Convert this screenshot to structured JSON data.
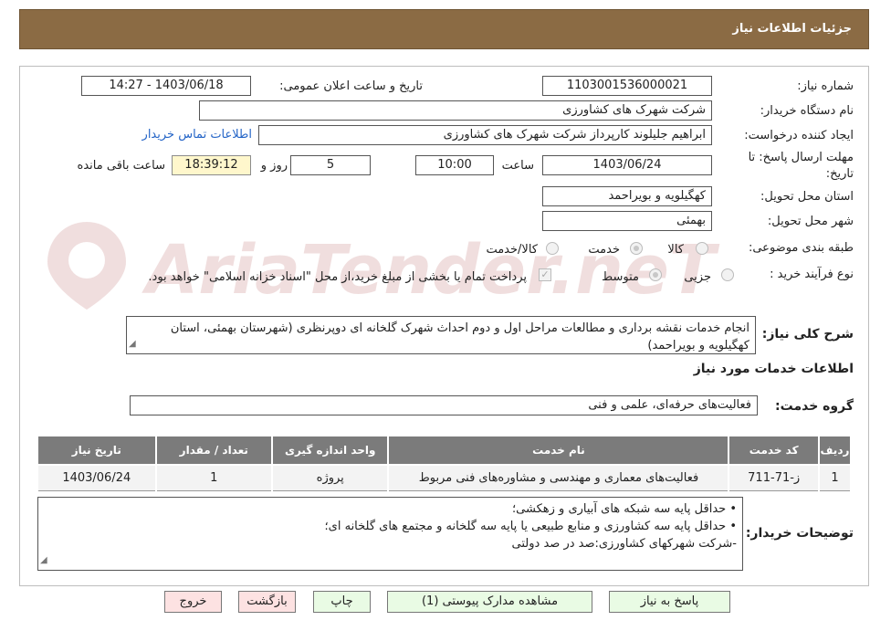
{
  "header": {
    "title": "جزئیات اطلاعات نیاز"
  },
  "form": {
    "need_number_label": "شماره نیاز:",
    "need_number": "1103001536000021",
    "announce_label": "تاریخ و ساعت اعلان عمومی:",
    "announce_value": "1403/06/18 - 14:27",
    "buyer_org_label": "نام دستگاه خریدار:",
    "buyer_org": "شرکت شهرک های کشاورزی",
    "creator_label": "ایجاد کننده درخواست:",
    "creator": "ابراهیم جلیلوند کارپرداز شرکت شهرک های کشاورزی",
    "contact_link": "اطلاعات تماس خریدار",
    "deadline_label_1": "مهلت ارسال پاسخ: تا",
    "deadline_label_2": "تاریخ:",
    "deadline_date": "1403/06/24",
    "time_label": "ساعت",
    "deadline_time": "10:00",
    "days_value": "5",
    "days_label": "روز و",
    "remaining_time": "18:39:12",
    "remaining_label": "ساعت باقی مانده",
    "province_label": "استان محل تحویل:",
    "province": "کهگیلویه و بویراحمد",
    "city_label": "شهر محل تحویل:",
    "city": "بهمئی",
    "category_label": "طبقه بندی موضوعی:",
    "category_options": [
      "کالا",
      "خدمت",
      "کالا/خدمت"
    ],
    "category_selected": "خدمت",
    "process_label": "نوع فرآیند خرید :",
    "process_options": [
      "جزیی",
      "متوسط"
    ],
    "process_selected": "متوسط",
    "payment_note": "پرداخت تمام یا بخشی از مبلغ خرید،از محل \"اسناد خزانه اسلامی\" خواهد بود."
  },
  "description": {
    "label": "شرح کلی نیاز:",
    "text": "انجام خدمات نقشه برداری و مطالعات مراحل اول و دوم احداث شهرک گلخانه ای دوپرنظری (شهرستان بهمئی، استان کهگیلویه و بویراحمد)"
  },
  "services": {
    "section_title": "اطلاعات خدمات مورد نیاز",
    "group_label": "گروه خدمت:",
    "group_value": "فعالیت‌های حرفه‌ای، علمی و فنی",
    "columns": [
      "ردیف",
      "کد خدمت",
      "نام خدمت",
      "واحد اندازه گیری",
      "تعداد / مقدار",
      "تاریخ نیاز"
    ],
    "rows": [
      [
        "1",
        "ز-71-711",
        "فعالیت‌های معماری و مهندسی و مشاوره‌های فنی مربوط",
        "پروژه",
        "1",
        "1403/06/24"
      ]
    ]
  },
  "buyer_notes": {
    "label": "توضیحات خریدار:",
    "lines": [
      "• حداقل پایه سه شبکه های آبیاری و زهکشی؛",
      "• حداقل پایه سه کشاورزی و منابع طبیعی یا پایه سه گلخانه و مجتمع های گلخانه ای؛",
      "-شرکت شهرکهای کشاورزی:صد در صد دولتی"
    ]
  },
  "watermark": {
    "text": "AriaTender.neT"
  },
  "buttons": {
    "respond": "پاسخ به نیاز",
    "attachments": "مشاهده مدارک پیوستی (1)",
    "print": "چاپ",
    "back": "بازگشت",
    "exit": "خروج"
  },
  "colors": {
    "header_bg": "#8b6b44",
    "table_header_bg": "#7b7b7b",
    "link": "#2565c7",
    "timer_bg": "#fff7cc",
    "button_green": "#e9fbe4",
    "button_pink": "#fde2e2"
  }
}
